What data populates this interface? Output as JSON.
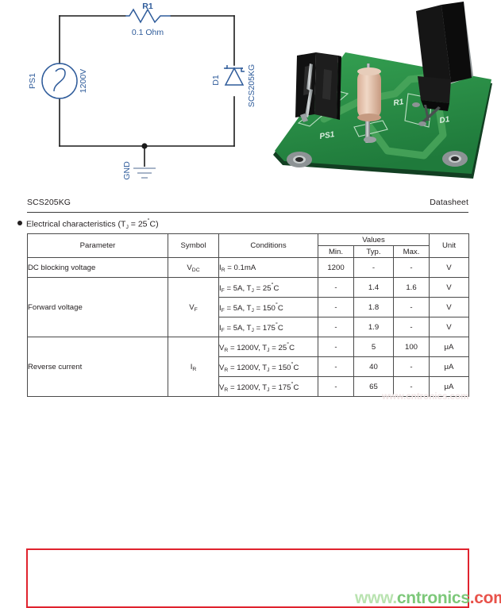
{
  "schematic": {
    "resistor": {
      "ref": "R1",
      "value": "0.1 Ohm"
    },
    "source": {
      "ref": "PS1",
      "value": "1200V"
    },
    "diode": {
      "ref": "D1",
      "part": "SCS205KG"
    },
    "ground": {
      "label": "GND"
    }
  },
  "pcb": {
    "silkscreen": {
      "ps1": "PS1",
      "r1": "R1",
      "d1": "D1"
    },
    "colors": {
      "board": "#2f8d46",
      "trace": "#4aa05c",
      "silk": "#cfe9d4",
      "pad": "#9aa0a0",
      "body": "#1b1b1b",
      "resistor": "#e3c3ac"
    }
  },
  "datasheet": {
    "header": {
      "part_number": "SCS205KG",
      "doc_type": "Datasheet"
    },
    "section_title": "Electrical characteristics (T",
    "section_title_sub": "J",
    "section_title_tail": " = 25",
    "section_title_unit": "C)",
    "table": {
      "columns": [
        "Parameter",
        "Symbol",
        "Conditions",
        "Values",
        "Unit"
      ],
      "values_subcolumns": [
        "Min.",
        "Typ.",
        "Max."
      ],
      "rows": [
        {
          "parameter": "DC blocking voltage",
          "symbol_base": "V",
          "symbol_sub": "DC",
          "conditions": [
            {
              "prefix": "I",
              "sub": "R",
              "text": " = 0.1mA",
              "min": "1200",
              "typ": "-",
              "max": "-",
              "unit": "V"
            }
          ]
        },
        {
          "parameter": "Forward voltage",
          "symbol_base": "V",
          "symbol_sub": "F",
          "conditions": [
            {
              "prefix": "I",
              "sub": "F",
              "text": " = 5A, T",
              "sub2": "J",
              "text2": " = 25",
              "deg": "C",
              "min": "-",
              "typ": "1.4",
              "max": "1.6",
              "unit": "V"
            },
            {
              "prefix": "I",
              "sub": "F",
              "text": " = 5A, T",
              "sub2": "J",
              "text2": " = 150",
              "deg": "C",
              "min": "-",
              "typ": "1.8",
              "max": "-",
              "unit": "V"
            },
            {
              "prefix": "I",
              "sub": "F",
              "text": " = 5A, T",
              "sub2": "J",
              "text2": " = 175",
              "deg": "C",
              "min": "-",
              "typ": "1.9",
              "max": "-",
              "unit": "V"
            }
          ]
        },
        {
          "parameter": "Reverse current",
          "symbol_base": "I",
          "symbol_sub": "R",
          "highlighted": true,
          "conditions": [
            {
              "prefix": "V",
              "sub": "R",
              "text": " = 1200V, T",
              "sub2": "J",
              "text2": " = 25",
              "deg": "C",
              "min": "-",
              "typ": "5",
              "max": "100",
              "unit": "μA"
            },
            {
              "prefix": "V",
              "sub": "R",
              "text": " = 1200V, T",
              "sub2": "J",
              "text2": " = 150",
              "deg": "C",
              "min": "-",
              "typ": "40",
              "max": "-",
              "unit": "μA"
            },
            {
              "prefix": "V",
              "sub": "R",
              "text": " = 1200V, T",
              "sub2": "J",
              "text2": " = 175",
              "deg": "C",
              "min": "-",
              "typ": "65",
              "max": "-",
              "unit": "μA"
            }
          ]
        }
      ]
    },
    "highlight_color": "#e0232e"
  },
  "watermark": {
    "part_a": "www.",
    "part_b": "cntronics",
    "part_c": ".com",
    "full": "www.cntronics.com",
    "top_text": "www.cntronics.com"
  }
}
